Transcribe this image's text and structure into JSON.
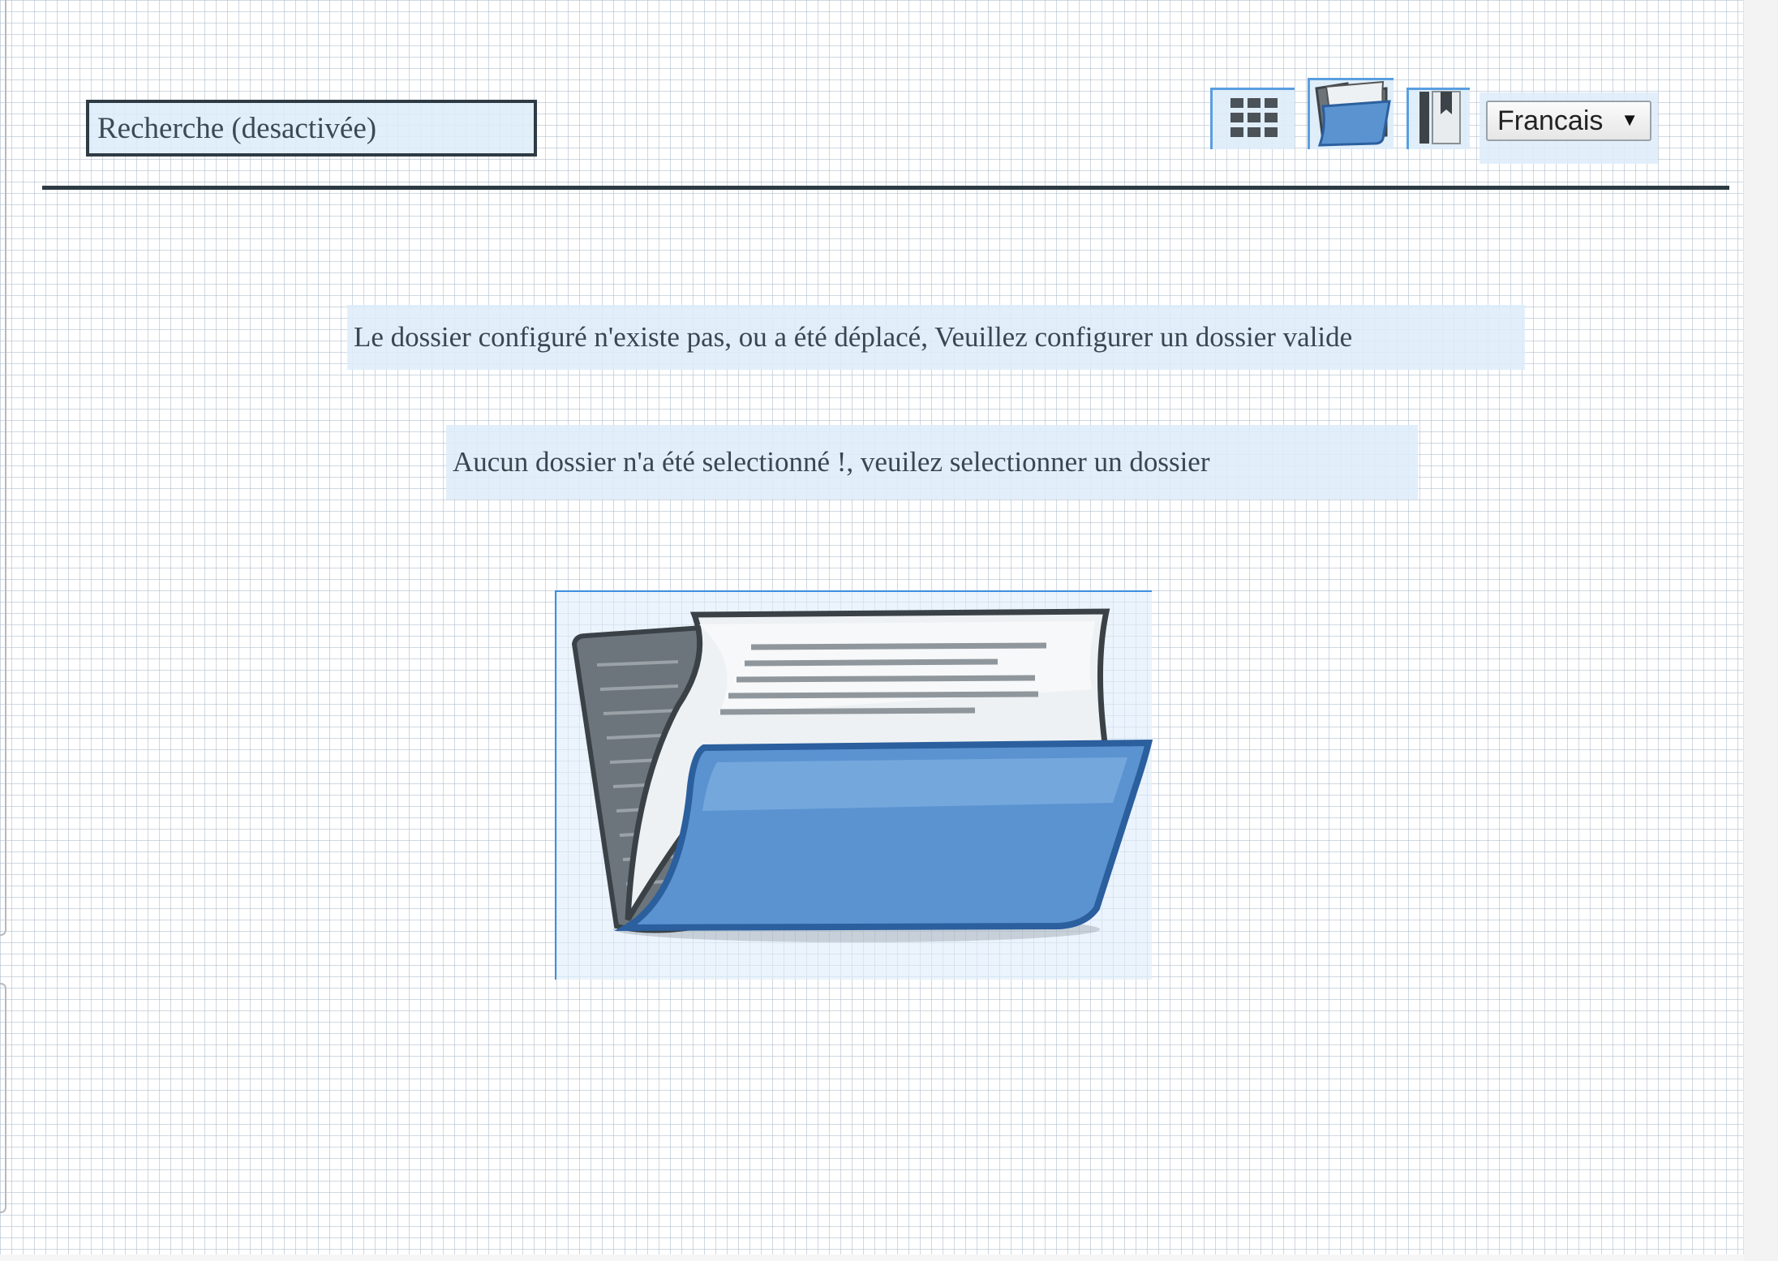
{
  "header": {
    "search_placeholder": "Recherche (desactivée)",
    "view_buttons": [
      {
        "name": "grid-view",
        "icon": "grid-icon"
      },
      {
        "name": "folder-view",
        "icon": "folder-open-icon"
      },
      {
        "name": "bookmarks",
        "icon": "bookmark-icon"
      }
    ],
    "language": {
      "selected": "Francais"
    }
  },
  "main": {
    "messages": [
      "Le dossier configuré n'existe pas, ou a été déplacé, Veuillez configurer un dossier valide",
      "Aucun dossier n'a été selectionné !, veuilez selectionner un dossier"
    ],
    "illustration_icon": "folder-open-icon"
  },
  "colors": {
    "accent": "#3d8ee0",
    "folder_blue": "#5b93d1",
    "rule": "#2c3a44"
  }
}
